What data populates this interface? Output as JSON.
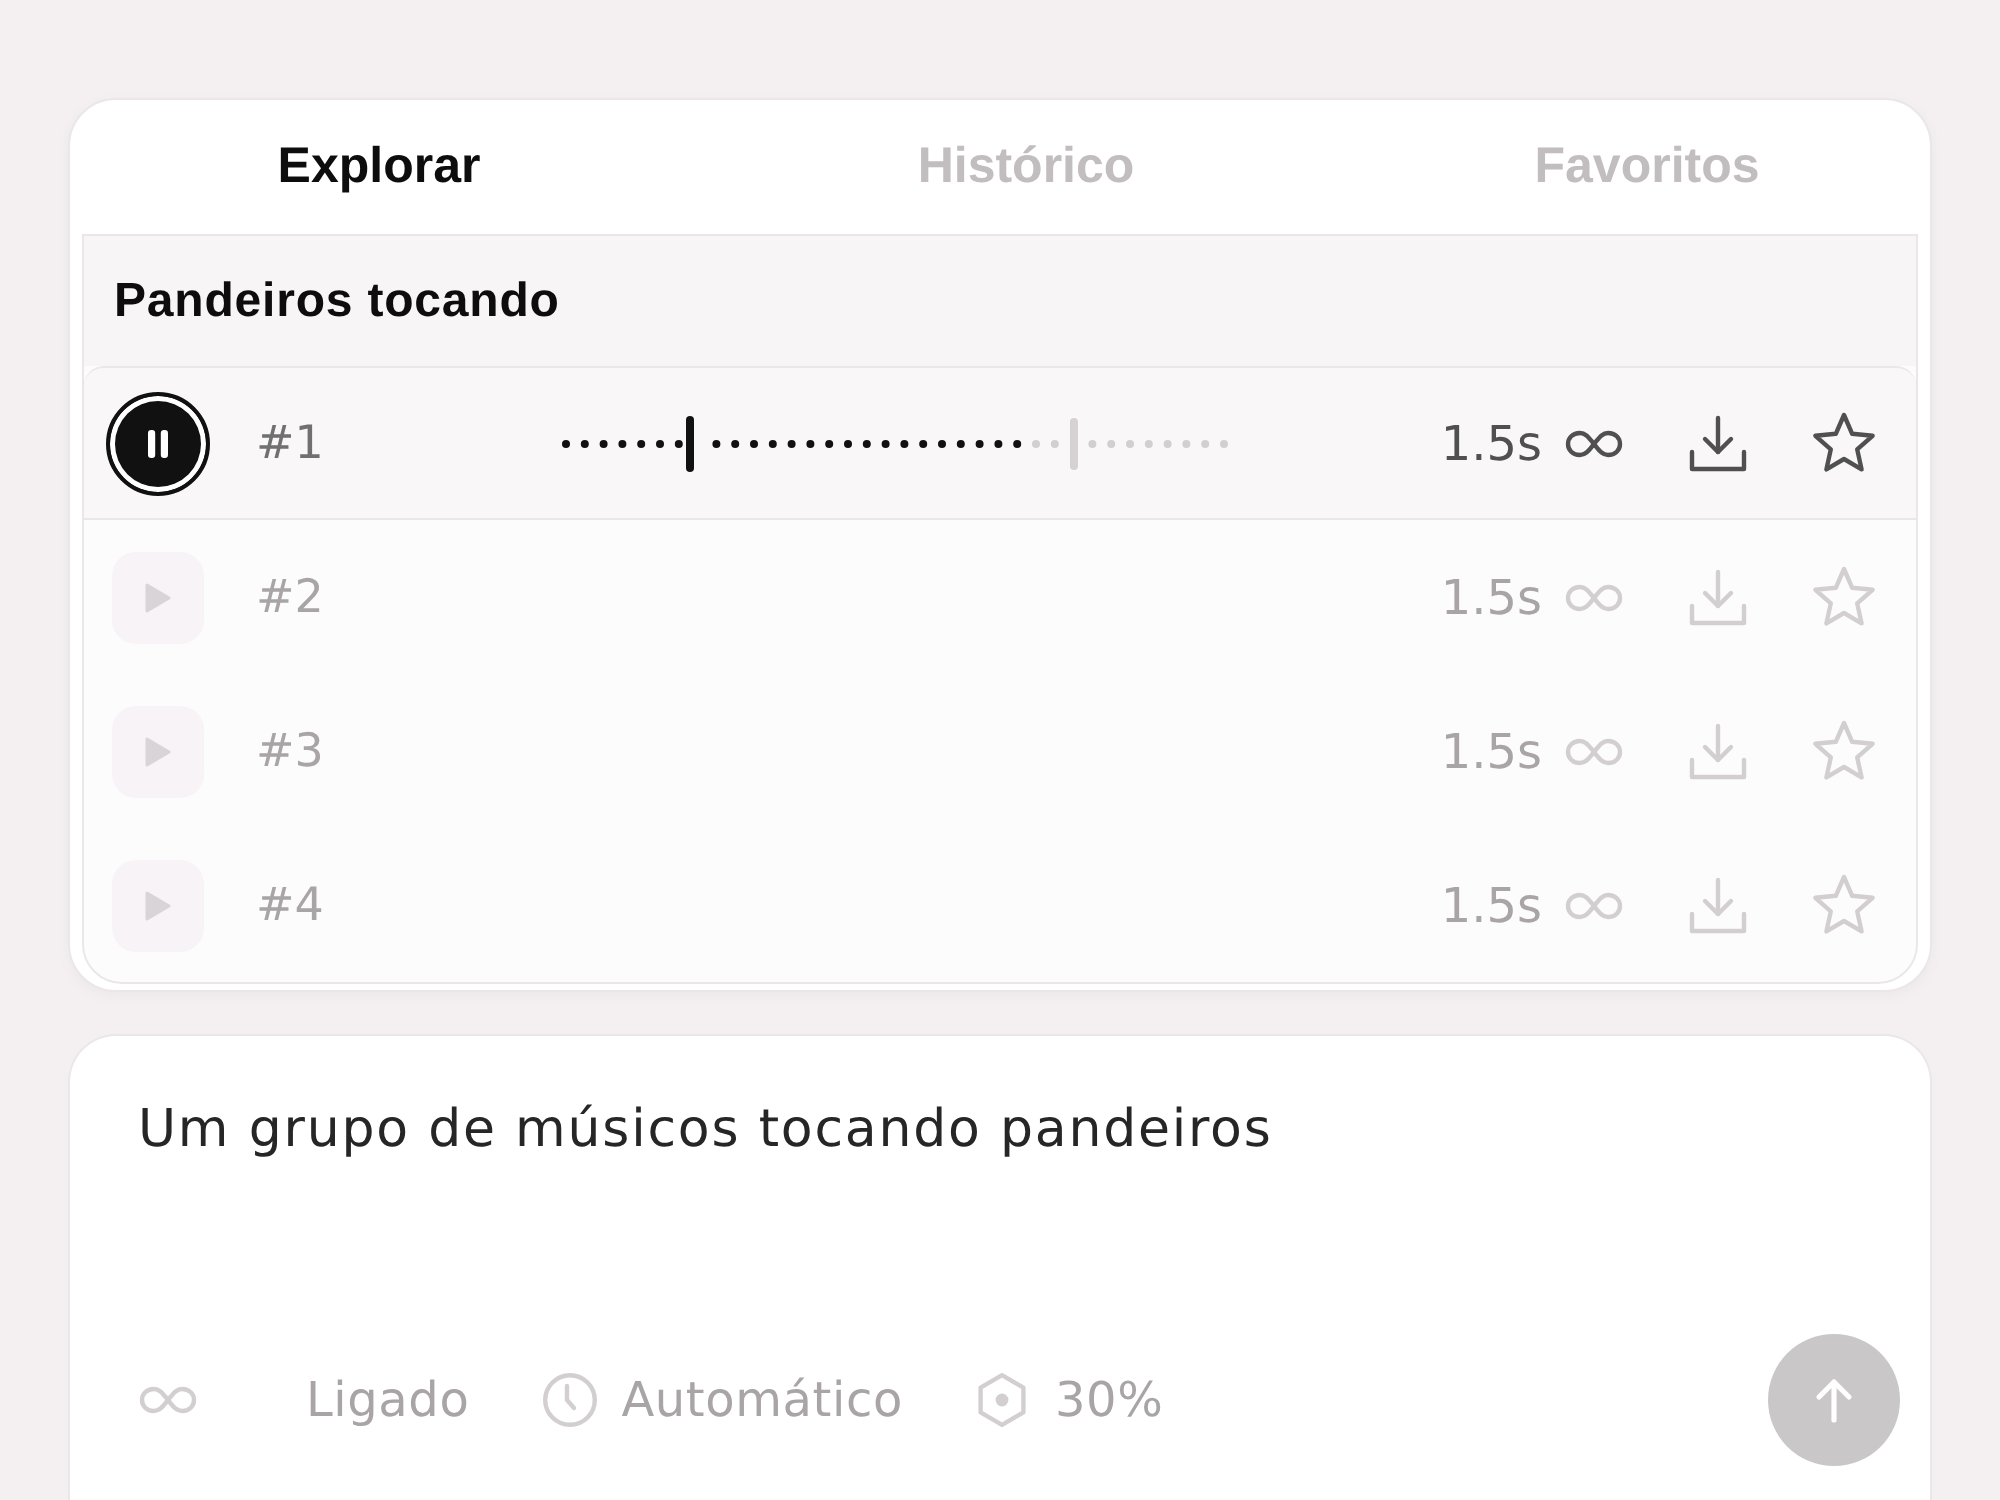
{
  "tabs": [
    {
      "label": "Explorar",
      "selected": true
    },
    {
      "label": "Histórico",
      "selected": false
    },
    {
      "label": "Favoritos",
      "selected": false
    }
  ],
  "results": {
    "title": "Pandeiros tocando",
    "rows": [
      {
        "number": "#1",
        "duration": "1.5s",
        "playing": true,
        "disabled": false,
        "favorite": false,
        "level": 0.19
      },
      {
        "number": "#2",
        "duration": "1.5s",
        "playing": false,
        "disabled": true,
        "favorite": false
      },
      {
        "number": "#3",
        "duration": "1.5s",
        "playing": false,
        "disabled": true,
        "favorite": false
      },
      {
        "number": "#4",
        "duration": "1.5s",
        "playing": false,
        "disabled": true,
        "favorite": false
      }
    ]
  },
  "prompt": {
    "value": "Um grupo de músicos tocando pandeiros"
  },
  "options": [
    {
      "kind": "loop",
      "label": "Ligado",
      "disabled": true
    },
    {
      "kind": "duration",
      "label": "Automático",
      "disabled": true
    },
    {
      "kind": "influence",
      "label": "30%",
      "disabled": true
    }
  ],
  "send_button": {
    "disabled": true
  }
}
